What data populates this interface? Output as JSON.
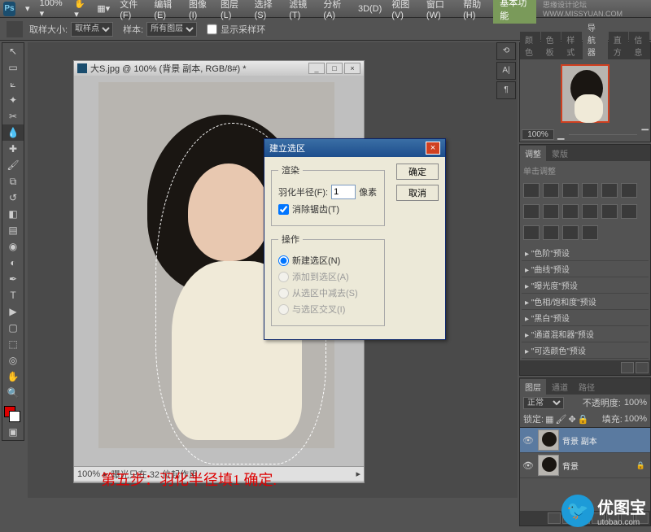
{
  "app": {
    "name": "Ps"
  },
  "menu": {
    "file": "文件(F)",
    "edit": "编辑(E)",
    "image": "图像(I)",
    "layer": "图层(L)",
    "select": "选择(S)",
    "filter": "滤镜(T)",
    "analysis": "分析(A)",
    "threed": "3D(D)",
    "view": "视图(V)",
    "window": "窗口(W)",
    "help": "帮助(H)",
    "zoom_mb": "100% ▾",
    "basic_fn": "基本功能",
    "watermark": "思缘设计论坛  WWW.MISSYUAN.COM"
  },
  "options": {
    "sample_size": "取样大小:",
    "sample_val": "取样点",
    "sample": "样本:",
    "sample_scope": "所有图层",
    "show_ring": "显示采样环"
  },
  "doc": {
    "title": "大S.jpg @ 100% (背景 副本, RGB/8#) *",
    "zoom": "100%",
    "status": "曝光只在 32 位起作用"
  },
  "step_text": "第五步：羽化半径填1  确定.",
  "dialog": {
    "title": "建立选区",
    "feather_group": "渲染",
    "feather_label": "羽化半径(F):",
    "feather_val": "1",
    "px": "像素",
    "antialias": "消除锯齿(T)",
    "op_group": "操作",
    "op_new": "新建选区(N)",
    "op_add": "添加到选区(A)",
    "op_sub": "从选区中减去(S)",
    "op_int": "与选区交叉(I)",
    "ok": "确定",
    "cancel": "取消"
  },
  "panels": {
    "nav": {
      "tabs": [
        "颜色",
        "色板",
        "样式",
        "导航器",
        "直方",
        "信息"
      ],
      "zoom": "100%"
    },
    "adjust": {
      "tabs": [
        "调整",
        "蒙版"
      ],
      "hint": "单击调整"
    },
    "presets": [
      "\"色阶\"预设",
      "\"曲线\"预设",
      "\"曝光度\"预设",
      "\"色相/饱和度\"预设",
      "\"黑白\"预设",
      "\"通道混和器\"预设",
      "\"可选颜色\"预设"
    ],
    "layers": {
      "tabs": [
        "图层",
        "通道",
        "路径"
      ],
      "blend": "正常",
      "opacity_lbl": "不透明度:",
      "opacity": "100%",
      "lock_lbl": "锁定:",
      "fill_lbl": "填充:",
      "fill": "100%",
      "items": [
        {
          "name": "背景 副本",
          "sel": true
        },
        {
          "name": "背景",
          "sel": false,
          "locked": true
        }
      ]
    }
  },
  "logo": {
    "brand": "优图宝",
    "domain": "utobao.com"
  }
}
